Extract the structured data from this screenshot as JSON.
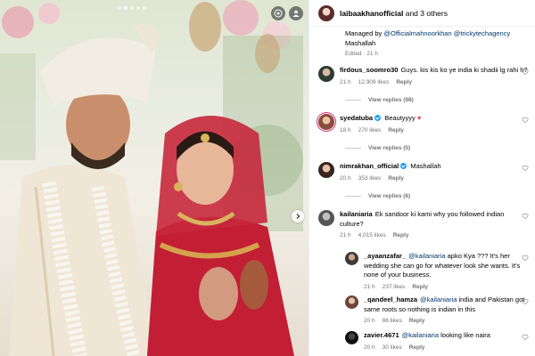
{
  "post": {
    "photo": {
      "carousel_total": 5,
      "carousel_active": 2,
      "icons": [
        "add-circle-icon",
        "tag-person-icon",
        "chevron-right-icon"
      ]
    },
    "header": {
      "username": "laibaakhanofficial",
      "collaborators": "and 3 others"
    },
    "caption": {
      "managed_prefix": "Managed by",
      "mention_1": "@Officialmahnoorkhan",
      "mention_2": "@trickytechagency",
      "text": "Mashallah",
      "edited": "Edited · 21 h"
    }
  },
  "comments": [
    {
      "username": "firdous_soomro30",
      "text": "Guys. kis kis ko ye india ki shadii lg rahi h?",
      "time": "21 h",
      "likes": "12,909 likes",
      "reply_label": "Reply",
      "view_replies": "View replies (98)"
    },
    {
      "username": "syedatuba",
      "verified": true,
      "text": "Beautyyyy",
      "emoji": "♥",
      "time": "18 h",
      "likes": "270 likes",
      "reply_label": "Reply",
      "view_replies": "View replies (5)"
    },
    {
      "username": "nimrakhan_official",
      "verified": true,
      "text": "Mashallah",
      "time": "20 h",
      "likes": "353 likes",
      "reply_label": "Reply",
      "view_replies": "View replies (6)"
    },
    {
      "username": "kailaniaria",
      "text": "Ek sandoor ki kami why you followed indian culture?",
      "time": "21 h",
      "likes": "4,015 likes",
      "reply_label": "Reply"
    }
  ],
  "replies": [
    {
      "username": "_ayaanzafar_",
      "mention": "@kailaniaria",
      "text": "apko Kya ??? It's her wedding she can go for whatever look she wants. It's none of your business.",
      "time": "21 h",
      "likes": "237 likes",
      "reply_label": "Reply"
    },
    {
      "username": "_qandeel_hamza",
      "mention": "@kailaniaria",
      "text": "india and Pakistan got same roots so nothing is indian in this",
      "time": "20 h",
      "likes": "86 likes",
      "reply_label": "Reply"
    },
    {
      "username": "zavier.4671",
      "mention": "@kailaniaria",
      "text": "looking like naira",
      "time": "20 h",
      "likes": "30 likes",
      "reply_label": "Reply"
    }
  ],
  "colors": {
    "link": "#00376b",
    "muted": "#737373",
    "verified": "#1d9bf0",
    "heart": "#ed4956"
  }
}
